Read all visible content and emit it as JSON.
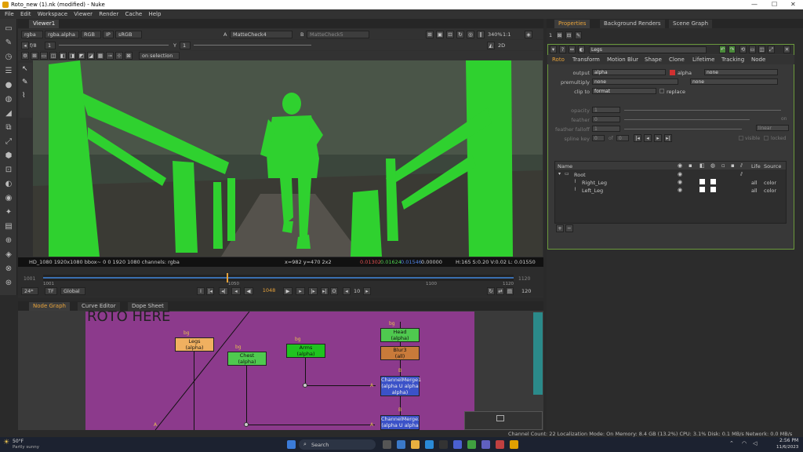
{
  "window": {
    "title": "Roto_new (1).nk (modified) - Nuke"
  },
  "menu": [
    "File",
    "Edit",
    "Workspace",
    "Viewer",
    "Render",
    "Cache",
    "Help"
  ],
  "viewer": {
    "tab": "Viewer1",
    "channels": "rgba",
    "alpha": "rgba.alpha",
    "colorspace_mode": "RGB",
    "ip": "IP",
    "lut": "sRGB",
    "a_label": "A",
    "a_input": "MatteCheck4",
    "b_label": "B",
    "b_input": "MatteCheck5",
    "gain": "1",
    "fstop": "f/8",
    "frame": "1",
    "y": "Y",
    "y_val": "1",
    "zoom": "340%",
    "ratio": "1:1",
    "mode": "2D",
    "update": "on selection",
    "info_left": "HD_1080 1920x1080  bbox~ 0 0 1920 1080 channels: rgba",
    "info_coord": "x=982 y=470 2x2",
    "info_r": "0.01302",
    "info_g": "0.01624",
    "info_b": "0.01546",
    "info_a": "0.00000",
    "info_hsv": "H:165 S:0.20 V:0.02  L: 0.01550"
  },
  "timeline": {
    "start_frame": "1001",
    "end_frame": "1120",
    "tick_1001": "1001",
    "tick_1050": "1050",
    "tick_1100": "1100",
    "tick_1120": "1120",
    "fps": "24*",
    "tf": "TF",
    "scope": "Global",
    "current_frame": "1048",
    "step": "10",
    "range_end": "120"
  },
  "lower_tabs": [
    "Node Graph",
    "Curve Editor",
    "Dope Sheet"
  ],
  "nodegraph": {
    "backdrop_label": "ROTO HERE",
    "nodes": {
      "legs": "Legs\n(alpha)",
      "chest": "Chest\n(alpha)",
      "arms": "Arms\n(alpha)",
      "head": "Head\n(alpha)",
      "blur": "Blur3\n(all)",
      "cm1": "ChannelMerge1\n(alpha U alpha\nalpha)",
      "cm2": "ChannelMerge2\n(alpha U alpha"
    },
    "input_labels": {
      "bg": "bg",
      "b": "B",
      "a": "A"
    }
  },
  "right_tabs": [
    "Properties",
    "Background Renders",
    "Scene Graph"
  ],
  "properties": {
    "max_panels": "1",
    "node_name": "Legs",
    "tabs": [
      "Roto",
      "Transform",
      "Motion Blur",
      "Shape",
      "Clone",
      "Lifetime",
      "Tracking",
      "Node"
    ],
    "output_label": "output",
    "output_val": "alpha",
    "alpha_label": "alpha",
    "none1": "none",
    "premultiply_label": "premultiply",
    "premultiply_val": "none",
    "none2": "none",
    "clipto_label": "clip to",
    "clipto_val": "format",
    "replace_label": "replace",
    "opacity_label": "opacity",
    "opacity_val": "1",
    "feather_label": "feather",
    "feather_val": "0",
    "featherfalloff_label": "feather falloff",
    "featherfalloff_val": "1",
    "linear": "linear",
    "on_label": "on",
    "splinekey_label": "spline key",
    "splinekey_val": "0",
    "of": "of",
    "splinekey_total": "0",
    "visible_label": "visible",
    "locked_label": "locked",
    "col_name": "Name",
    "col_life": "Life",
    "col_source": "Source",
    "tree": [
      {
        "name": "Root",
        "life": "",
        "source": ""
      },
      {
        "name": "Right_Leg",
        "life": "all",
        "source": "color"
      },
      {
        "name": "Left_Leg",
        "life": "all",
        "source": "color"
      }
    ]
  },
  "statusbar": "Channel Count: 22  Localization Mode: On  Memory: 8.4 GB (13.2%)  CPU: 3.1%  Disk: 0.1 MB/s  Network: 0.0 MB/s",
  "taskbar": {
    "weather_temp": "50°F",
    "weather_desc": "Partly sunny",
    "search": "Search",
    "time": "2:56 PM",
    "date": "11/6/2023"
  },
  "colors": {
    "roto_green": "#2fd12f",
    "backdrop": "#8c3a8c",
    "legs_node": "#f0b060",
    "roto_node": "#4fc94f",
    "blur_node": "#c87a3a",
    "merge_node": "#3b52c8"
  }
}
